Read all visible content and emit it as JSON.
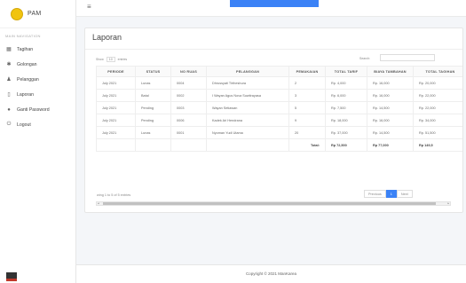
{
  "app": {
    "name": "PAM",
    "accent": "#3b82f6",
    "logo_color": "#f1c40f"
  },
  "sidebar": {
    "header": "MAIN NAVIGATION",
    "items": [
      {
        "label": "Tagihan",
        "icon": "grid-icon"
      },
      {
        "label": "Golongan",
        "icon": "gear-icon"
      },
      {
        "label": "Pelanggan",
        "icon": "users-icon"
      },
      {
        "label": "Laporan",
        "icon": "file-icon"
      },
      {
        "label": "Ganti Password",
        "icon": "dot-icon"
      },
      {
        "label": "Logout",
        "icon": "power-icon"
      }
    ]
  },
  "topbar": {
    "menu_icon": "hamburger-icon"
  },
  "card": {
    "title": "Laporan",
    "length_prefix": "Show",
    "length_value": "10",
    "length_suffix": "entries",
    "search_label": "Search:",
    "info": "wing 1 to 5 of 5 entries",
    "pagination": {
      "previous": "Previous",
      "current": "1",
      "next": "Next"
    }
  },
  "table": {
    "columns": [
      "Periode",
      "Status",
      "No Ruas",
      "Pelanggan",
      "Pemakaian",
      "Total Tarif",
      "Biaya Tambahan",
      "Total Tagihan"
    ],
    "rows": [
      [
        "July 2021",
        "Lunas",
        "0004",
        "Dhrussyati Tirtheshura",
        "2",
        "Rp. 4,000",
        "Rp. 16,000",
        "Rp. 20,000"
      ],
      [
        "July 2021",
        "Batal",
        "0002",
        "I Wayan Agus Nova Suwitrayasa",
        "3",
        "Rp. 6,000",
        "Rp. 16,000",
        "Rp. 22,000"
      ],
      [
        "July 2021",
        "Pending",
        "0003",
        "Wayan Setiawan",
        "5",
        "Rp. 7,500",
        "Rp. 14,500",
        "Rp. 22,000"
      ],
      [
        "July 2021",
        "Pending",
        "0006",
        "Kadek Ari Hendrana",
        "9",
        "Rp. 18,000",
        "Rp. 16,000",
        "Rp. 34,000"
      ],
      [
        "July 2021",
        "Lunas",
        "0001",
        "Nyoman Yudi Utama",
        "20",
        "Rp. 37,000",
        "Rp. 14,500",
        "Rp. 51,500"
      ]
    ],
    "total": {
      "label": "Total:",
      "tarif": "Rp 72,500",
      "tambahan": "Rp 77,000",
      "tagihan": "Rp 149,5"
    }
  },
  "footer": {
    "text": "Copyright © 2021 ManKarea"
  }
}
